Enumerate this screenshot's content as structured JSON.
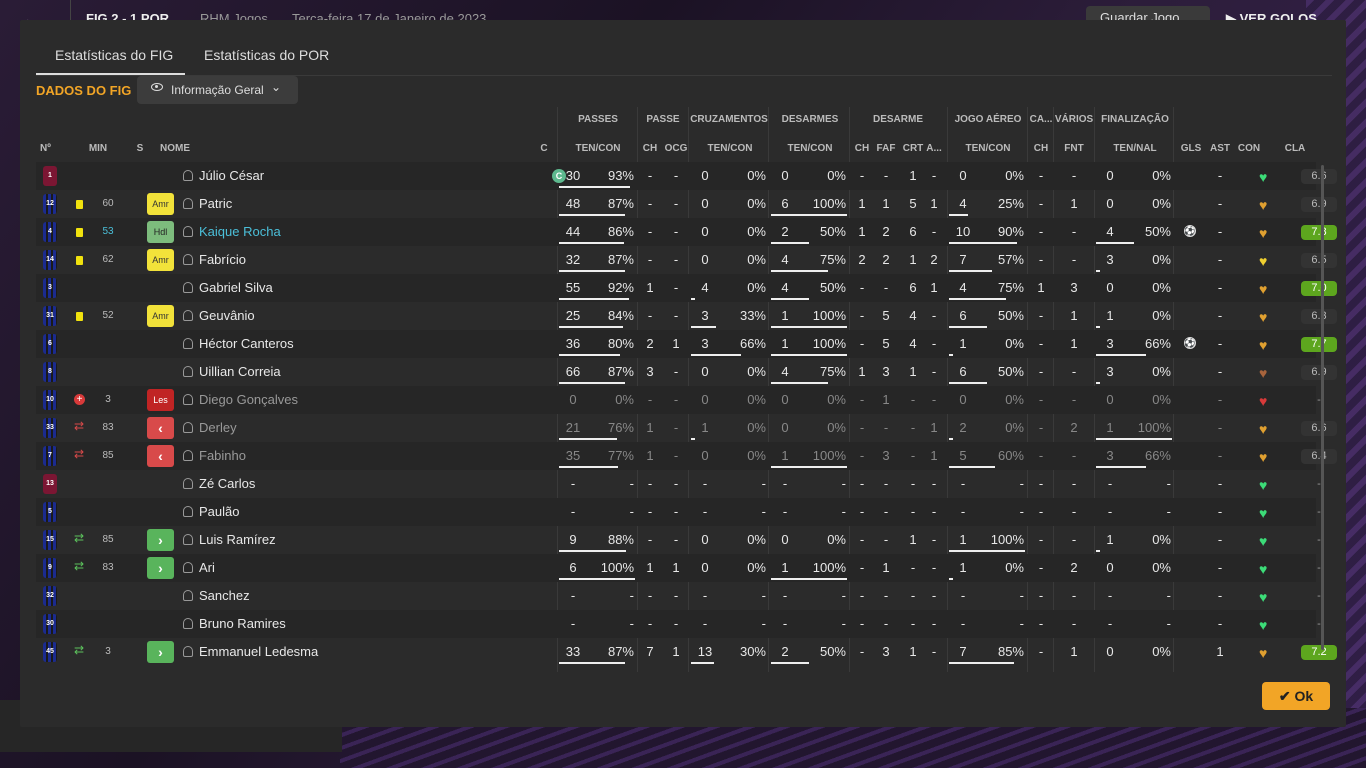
{
  "topbar": {
    "back_icon": "arrow-left-icon",
    "score": "FIG 2 - 1 POR",
    "meta": "RHM Jogos",
    "date": "Terça-feira 17 de Janeiro de 2023",
    "save_label": "Guardar Jogo",
    "see_goals_label": "VER GOLOS"
  },
  "tabs": [
    "Estatísticas do FIG",
    "Estatísticas do POR"
  ],
  "section_title": "DADOS DO FIG",
  "view_dropdown": {
    "selected": "Informação Geral",
    "icon": "eye-icon"
  },
  "group_headers": [
    "PASSES",
    "PASSE",
    "CRUZAMENTOS",
    "DESARMES",
    "DESARME",
    "JOGO AÉREO",
    "CA...",
    "VÁRIOS",
    "FINALIZAÇÃO"
  ],
  "columns": [
    "Nº",
    "MIN",
    "S",
    "NOME",
    "C",
    "TEN/CON",
    "CH",
    "OCG",
    "TEN/CON",
    "TEN/CON",
    "CH",
    "FAF",
    "CRT",
    "A...",
    "TEN/CON",
    "CH",
    "FNT",
    "TEN/NAL",
    "GLS",
    "AST",
    "CON",
    "CLA"
  ],
  "ok_label": "Ok",
  "colors": {
    "accent": "#f2a526",
    "highlight": "#4bbfd9",
    "rating_green": "#5da61e",
    "heart_green": "#3cdc78",
    "heart_orange": "#e0a030"
  },
  "players": [
    {
      "num": "1",
      "min": "",
      "status": "",
      "name": "Júlio César",
      "captain": "C",
      "pass": [
        "30",
        "93%"
      ],
      "pch": "-",
      "pocg": "-",
      "cruz": [
        "0",
        "0%"
      ],
      "des": [
        "0",
        "0%"
      ],
      "dch": "-",
      "faf": "-",
      "crt": "1",
      "a": "-",
      "aer": [
        "0",
        "0%"
      ],
      "ca": "-",
      "fnt": "-",
      "fin": [
        "0",
        "0%"
      ],
      "gls": "",
      "ast": "-",
      "con": "green",
      "cla": "6.6"
    },
    {
      "num": "12",
      "min": "60",
      "status": "Amr",
      "name": "Patric",
      "captain": "",
      "pass": [
        "48",
        "87%"
      ],
      "pch": "-",
      "pocg": "-",
      "cruz": [
        "0",
        "0%"
      ],
      "des": [
        "6",
        "100%"
      ],
      "dch": "1",
      "faf": "1",
      "crt": "5",
      "a": "1",
      "aer": [
        "4",
        "25%"
      ],
      "ca": "-",
      "fnt": "1",
      "fin": [
        "0",
        "0%"
      ],
      "gls": "",
      "ast": "-",
      "con": "orange",
      "cla": "6.9"
    },
    {
      "num": "4",
      "min": "53",
      "status": "Hdl",
      "name": "Kaique Rocha",
      "captain": "",
      "pass": [
        "44",
        "86%"
      ],
      "pch": "-",
      "pocg": "-",
      "cruz": [
        "0",
        "0%"
      ],
      "des": [
        "2",
        "50%"
      ],
      "dch": "1",
      "faf": "2",
      "crt": "6",
      "a": "-",
      "aer": [
        "10",
        "90%"
      ],
      "ca": "-",
      "fnt": "-",
      "fin": [
        "4",
        "50%"
      ],
      "gls": "⚽",
      "ast": "-",
      "con": "orange",
      "cla": "7.8"
    },
    {
      "num": "14",
      "min": "62",
      "status": "Amr",
      "name": "Fabrício",
      "captain": "",
      "pass": [
        "32",
        "87%"
      ],
      "pch": "-",
      "pocg": "-",
      "cruz": [
        "0",
        "0%"
      ],
      "des": [
        "4",
        "75%"
      ],
      "dch": "2",
      "faf": "2",
      "crt": "1",
      "a": "2",
      "aer": [
        "7",
        "57%"
      ],
      "ca": "-",
      "fnt": "-",
      "fin": [
        "3",
        "0%"
      ],
      "gls": "",
      "ast": "-",
      "con": "yellow",
      "cla": "6.5"
    },
    {
      "num": "3",
      "min": "",
      "status": "",
      "name": "Gabriel Silva",
      "captain": "",
      "pass": [
        "55",
        "92%"
      ],
      "pch": "1",
      "pocg": "-",
      "cruz": [
        "4",
        "0%"
      ],
      "des": [
        "4",
        "50%"
      ],
      "dch": "-",
      "faf": "-",
      "crt": "6",
      "a": "1",
      "aer": [
        "4",
        "75%"
      ],
      "ca": "1",
      "fnt": "3",
      "fin": [
        "0",
        "0%"
      ],
      "gls": "",
      "ast": "-",
      "con": "orange",
      "cla": "7.0"
    },
    {
      "num": "31",
      "min": "52",
      "status": "Amr",
      "name": "Geuvânio",
      "captain": "",
      "pass": [
        "25",
        "84%"
      ],
      "pch": "-",
      "pocg": "-",
      "cruz": [
        "3",
        "33%"
      ],
      "des": [
        "1",
        "100%"
      ],
      "dch": "-",
      "faf": "5",
      "crt": "4",
      "a": "-",
      "aer": [
        "6",
        "50%"
      ],
      "ca": "-",
      "fnt": "1",
      "fin": [
        "1",
        "0%"
      ],
      "gls": "",
      "ast": "-",
      "con": "orange",
      "cla": "6.3"
    },
    {
      "num": "6",
      "min": "",
      "status": "",
      "name": "Héctor Canteros",
      "captain": "",
      "pass": [
        "36",
        "80%"
      ],
      "pch": "2",
      "pocg": "1",
      "cruz": [
        "3",
        "66%"
      ],
      "des": [
        "1",
        "100%"
      ],
      "dch": "-",
      "faf": "5",
      "crt": "4",
      "a": "-",
      "aer": [
        "1",
        "0%"
      ],
      "ca": "-",
      "fnt": "1",
      "fin": [
        "3",
        "66%"
      ],
      "gls": "⚽",
      "ast": "-",
      "con": "orange",
      "cla": "7.7"
    },
    {
      "num": "8",
      "min": "",
      "status": "",
      "name": "Uillian Correia",
      "captain": "",
      "pass": [
        "66",
        "87%"
      ],
      "pch": "3",
      "pocg": "-",
      "cruz": [
        "0",
        "0%"
      ],
      "des": [
        "4",
        "75%"
      ],
      "dch": "1",
      "faf": "3",
      "crt": "1",
      "a": "-",
      "aer": [
        "6",
        "50%"
      ],
      "ca": "-",
      "fnt": "-",
      "fin": [
        "3",
        "0%"
      ],
      "gls": "",
      "ast": "-",
      "con": "brown",
      "cla": "6.9"
    },
    {
      "num": "10",
      "min": "3",
      "status": "Les",
      "name": "Diego Gonçalves",
      "captain": "",
      "pass": [
        "0",
        "0%"
      ],
      "pch": "-",
      "pocg": "-",
      "cruz": [
        "0",
        "0%"
      ],
      "des": [
        "0",
        "0%"
      ],
      "dch": "-",
      "faf": "1",
      "crt": "-",
      "a": "-",
      "aer": [
        "0",
        "0%"
      ],
      "ca": "-",
      "fnt": "-",
      "fin": [
        "0",
        "0%"
      ],
      "gls": "",
      "ast": "-",
      "con": "red",
      "cla": "-"
    },
    {
      "num": "33",
      "min": "83",
      "status": "out",
      "name": "Derley",
      "captain": "",
      "pass": [
        "21",
        "76%"
      ],
      "pch": "1",
      "pocg": "-",
      "cruz": [
        "1",
        "0%"
      ],
      "des": [
        "0",
        "0%"
      ],
      "dch": "-",
      "faf": "-",
      "crt": "-",
      "a": "1",
      "aer": [
        "2",
        "0%"
      ],
      "ca": "-",
      "fnt": "2",
      "fin": [
        "1",
        "100%"
      ],
      "gls": "",
      "ast": "-",
      "con": "orange",
      "cla": "6.6"
    },
    {
      "num": "7",
      "min": "85",
      "status": "out",
      "name": "Fabinho",
      "captain": "",
      "pass": [
        "35",
        "77%"
      ],
      "pch": "1",
      "pocg": "-",
      "cruz": [
        "0",
        "0%"
      ],
      "des": [
        "1",
        "100%"
      ],
      "dch": "-",
      "faf": "3",
      "crt": "-",
      "a": "1",
      "aer": [
        "5",
        "60%"
      ],
      "ca": "-",
      "fnt": "-",
      "fin": [
        "3",
        "66%"
      ],
      "gls": "",
      "ast": "-",
      "con": "orange",
      "cla": "6.4"
    },
    {
      "num": "13",
      "min": "",
      "status": "",
      "name": "Zé Carlos",
      "captain": "",
      "pass": [
        "-",
        "-"
      ],
      "pch": "-",
      "pocg": "-",
      "cruz": [
        "-",
        "-"
      ],
      "des": [
        "-",
        "-"
      ],
      "dch": "-",
      "faf": "-",
      "crt": "-",
      "a": "-",
      "aer": [
        "-",
        "-"
      ],
      "ca": "-",
      "fnt": "-",
      "fin": [
        "-",
        "-"
      ],
      "gls": "",
      "ast": "-",
      "con": "green",
      "cla": "-"
    },
    {
      "num": "5",
      "min": "",
      "status": "",
      "name": "Paulão",
      "captain": "",
      "pass": [
        "-",
        "-"
      ],
      "pch": "-",
      "pocg": "-",
      "cruz": [
        "-",
        "-"
      ],
      "des": [
        "-",
        "-"
      ],
      "dch": "-",
      "faf": "-",
      "crt": "-",
      "a": "-",
      "aer": [
        "-",
        "-"
      ],
      "ca": "-",
      "fnt": "-",
      "fin": [
        "-",
        "-"
      ],
      "gls": "",
      "ast": "-",
      "con": "green",
      "cla": "-"
    },
    {
      "num": "15",
      "min": "85",
      "status": "in",
      "name": "Luis Ramírez",
      "captain": "",
      "pass": [
        "9",
        "88%"
      ],
      "pch": "-",
      "pocg": "-",
      "cruz": [
        "0",
        "0%"
      ],
      "des": [
        "0",
        "0%"
      ],
      "dch": "-",
      "faf": "-",
      "crt": "1",
      "a": "-",
      "aer": [
        "1",
        "100%"
      ],
      "ca": "-",
      "fnt": "-",
      "fin": [
        "1",
        "0%"
      ],
      "gls": "",
      "ast": "-",
      "con": "green",
      "cla": "-"
    },
    {
      "num": "9",
      "min": "83",
      "status": "in",
      "name": "Ari",
      "captain": "",
      "pass": [
        "6",
        "100%"
      ],
      "pch": "1",
      "pocg": "1",
      "cruz": [
        "0",
        "0%"
      ],
      "des": [
        "1",
        "100%"
      ],
      "dch": "-",
      "faf": "1",
      "crt": "-",
      "a": "-",
      "aer": [
        "1",
        "0%"
      ],
      "ca": "-",
      "fnt": "2",
      "fin": [
        "0",
        "0%"
      ],
      "gls": "",
      "ast": "-",
      "con": "green",
      "cla": "-"
    },
    {
      "num": "32",
      "min": "",
      "status": "",
      "name": "Sanchez",
      "captain": "",
      "pass": [
        "-",
        "-"
      ],
      "pch": "-",
      "pocg": "-",
      "cruz": [
        "-",
        "-"
      ],
      "des": [
        "-",
        "-"
      ],
      "dch": "-",
      "faf": "-",
      "crt": "-",
      "a": "-",
      "aer": [
        "-",
        "-"
      ],
      "ca": "-",
      "fnt": "-",
      "fin": [
        "-",
        "-"
      ],
      "gls": "",
      "ast": "-",
      "con": "green",
      "cla": "-"
    },
    {
      "num": "30",
      "min": "",
      "status": "",
      "name": "Bruno Ramires",
      "captain": "",
      "pass": [
        "-",
        "-"
      ],
      "pch": "-",
      "pocg": "-",
      "cruz": [
        "-",
        "-"
      ],
      "des": [
        "-",
        "-"
      ],
      "dch": "-",
      "faf": "-",
      "crt": "-",
      "a": "-",
      "aer": [
        "-",
        "-"
      ],
      "ca": "-",
      "fnt": "-",
      "fin": [
        "-",
        "-"
      ],
      "gls": "",
      "ast": "-",
      "con": "green",
      "cla": "-"
    },
    {
      "num": "45",
      "min": "3",
      "status": "in",
      "name": "Emmanuel Ledesma",
      "captain": "",
      "pass": [
        "33",
        "87%"
      ],
      "pch": "7",
      "pocg": "1",
      "cruz": [
        "13",
        "30%"
      ],
      "des": [
        "2",
        "50%"
      ],
      "dch": "-",
      "faf": "3",
      "crt": "1",
      "a": "-",
      "aer": [
        "7",
        "85%"
      ],
      "ca": "-",
      "fnt": "1",
      "fin": [
        "0",
        "0%"
      ],
      "gls": "",
      "ast": "1",
      "con": "orange",
      "cla": "7.2"
    }
  ]
}
